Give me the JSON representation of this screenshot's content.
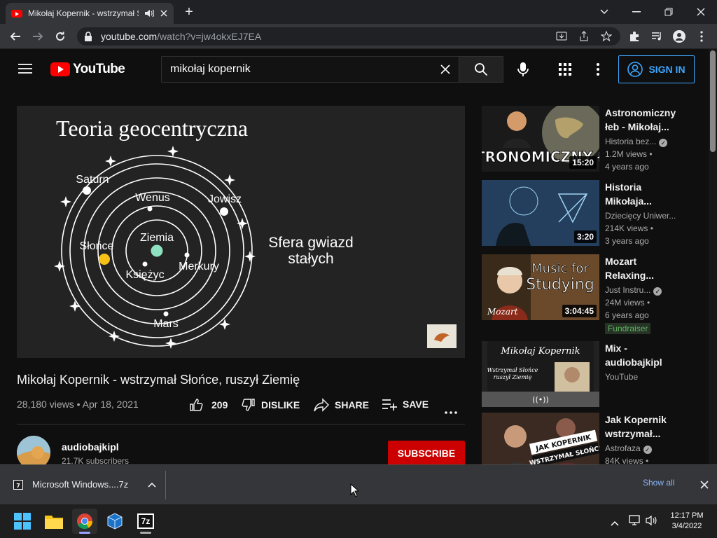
{
  "browser": {
    "tab_title": "Mikołaj Kopernik - wstrzymał Słońce, ruszył Ziemię",
    "new_tab_symbol": "+",
    "url_host": "youtube.com",
    "url_path": "/watch?v=jw4okxEJ7EA"
  },
  "youtube": {
    "logo_text": "YouTube",
    "search_query": "mikołaj kopernik",
    "sign_in": "SIGN IN"
  },
  "video": {
    "frame": {
      "heading": "Teoria geocentryczna",
      "earth": "Ziemia",
      "moon": "Księżyc",
      "mercury": "Merkury",
      "venus": "Wenus",
      "sun": "Słońce",
      "mars": "Mars",
      "jupiter": "Jowisz",
      "saturn": "Saturn",
      "stars_line1": "Sfera gwiazd",
      "stars_line2": "stałych"
    },
    "title": "Mikołaj Kopernik - wstrzymał Słońce, ruszył Ziemię",
    "views": "28,180 views",
    "date": "Apr 18, 2021",
    "meta_separator": "•",
    "likes": "209",
    "dislike_label": "DISLIKE",
    "share_label": "SHARE",
    "save_label": "SAVE",
    "channel": {
      "name": "audiobajkipl",
      "subscribers": "21.7K subscribers",
      "subscribe_label": "SUBSCRIBE"
    }
  },
  "recommendations": [
    {
      "title": "Astronomiczny łeb - Mikołaj...",
      "channel": "Historia bez...",
      "verified": true,
      "views": "1.2M views •",
      "age": "4 years ago",
      "duration": "15:20",
      "thumb_text": "ASTRONOMICZNY ŁEB"
    },
    {
      "title": "Historia Mikołaja...",
      "channel": "Dziecięcy Uniwer...",
      "verified": false,
      "views": "214K views •",
      "age": "3 years ago",
      "duration": "3:20"
    },
    {
      "title": "Mozart Relaxing...",
      "channel": "Just Instru...",
      "verified": true,
      "views": "24M views •",
      "age": "6 years ago",
      "duration": "3:04:45",
      "badge": "Fundraiser",
      "thumb_text_1": "Music for",
      "thumb_text_2": "Studying",
      "thumb_signature": "Mozart"
    },
    {
      "title": "Mix - audiobajkipl",
      "channel": "YouTube",
      "thumb_title": "Mikołaj Kopernik",
      "thumb_sub_1": "Wstrzymał Słońce",
      "thumb_sub_2": "ruszył Ziemię",
      "mix_icon_text": "((•))"
    },
    {
      "title": "Jak Kopernik wstrzymał...",
      "channel": "Astrofaza",
      "verified": true,
      "views": "84K views •",
      "thumb_text_1": "JAK KOPERNIK",
      "thumb_text_2": "WSTRZYMAŁ SŁOŃCE"
    }
  ],
  "downloads": {
    "file_name": "Microsoft Windows....7z",
    "file_icon": "7z-archive-icon",
    "show_all": "Show all"
  },
  "taskbar": {
    "sevenzip_label": "7z",
    "time": "12:17 PM",
    "date": "3/4/2022"
  }
}
